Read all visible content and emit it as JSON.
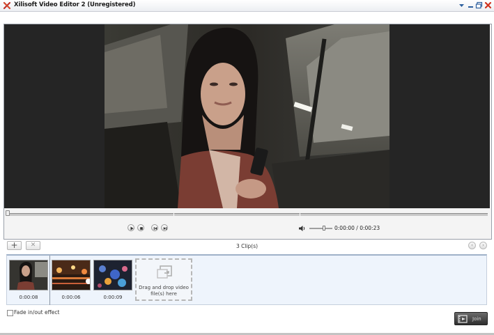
{
  "window": {
    "title": "Xilisoft Video Editor 2 (Unregistered)"
  },
  "player": {
    "time_display": "0:00:00 / 0:00:23"
  },
  "clips_toolbar": {
    "add_label": "+",
    "remove_label": "✕",
    "clip_count": "3 Clip(s)"
  },
  "clips": [
    {
      "duration": "0:00:08"
    },
    {
      "duration": "0:00:06"
    },
    {
      "duration": "0:00:09"
    }
  ],
  "drop_zone": {
    "text": "Drag and drop video file(s) here"
  },
  "options": {
    "fade_label": "Fade in/out effect",
    "fade_checked": false
  },
  "join_button": {
    "label": "Join"
  },
  "colors": {
    "video_bg": "#252525",
    "clips_bg": "#eef4fc",
    "join_bg": "#2e2e2e"
  }
}
